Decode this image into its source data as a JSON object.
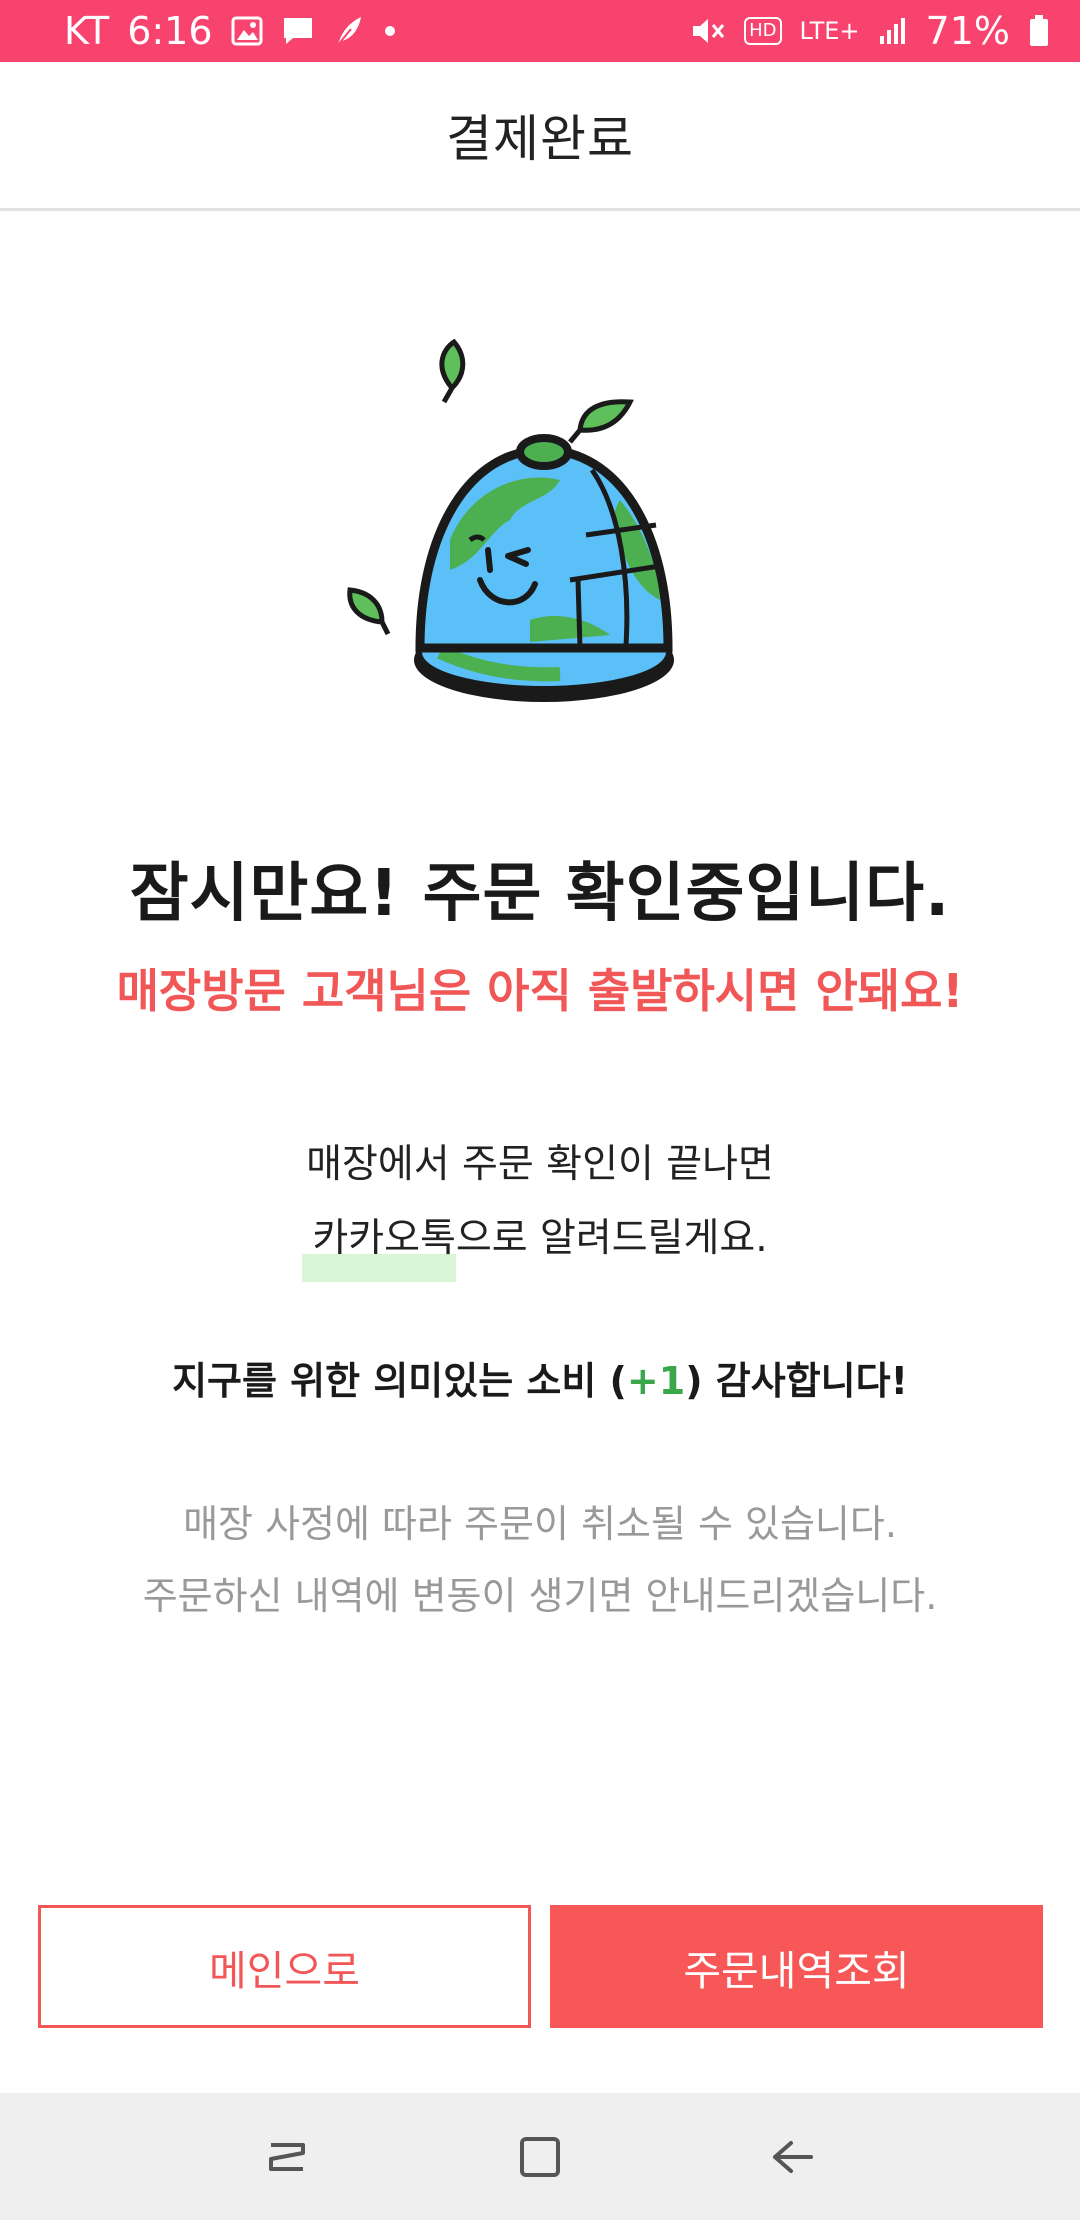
{
  "status_bar": {
    "carrier": "KT",
    "time": "6:16",
    "network": "LTE+",
    "hd": "HD",
    "battery": "71%",
    "icons": [
      "image-icon",
      "message-icon",
      "feather-icon",
      "dot-icon",
      "mute-icon",
      "hd-icon",
      "lte-icon",
      "signal-icon",
      "battery-icon"
    ],
    "color": "#f9436f"
  },
  "header": {
    "title": "결제완료"
  },
  "main": {
    "headline": "잠시만요! 주문 확인중입니다.",
    "warning": "매장방문 고객님은 아직 출발하시면 안돼요!",
    "notice_line1": "매장에서 주문 확인이 끝나면",
    "notice_highlight": "카카오톡",
    "notice_line2_rest": "으로 알려드릴게요.",
    "thanks_prefix": "지구를 위한 의미있는 소비 (",
    "thanks_plus": "+1",
    "thanks_suffix": ") 감사합니다!",
    "policy_line1": "매장 사정에 따라 주문이 취소될 수 있습니다.",
    "policy_line2": "주문하신 내역에 변동이 생기면 안내드리겠습니다."
  },
  "buttons": {
    "main_label": "메인으로",
    "orders_label": "주문내역조회"
  },
  "colors": {
    "accent": "#f25757",
    "highlight": "#d8f5d6",
    "plus_green": "#3aa84a",
    "globe_blue": "#5bc0f8",
    "globe_green": "#4caf50"
  },
  "nav_bar": {
    "icons": [
      "recent-apps-icon",
      "home-icon",
      "back-icon"
    ]
  }
}
